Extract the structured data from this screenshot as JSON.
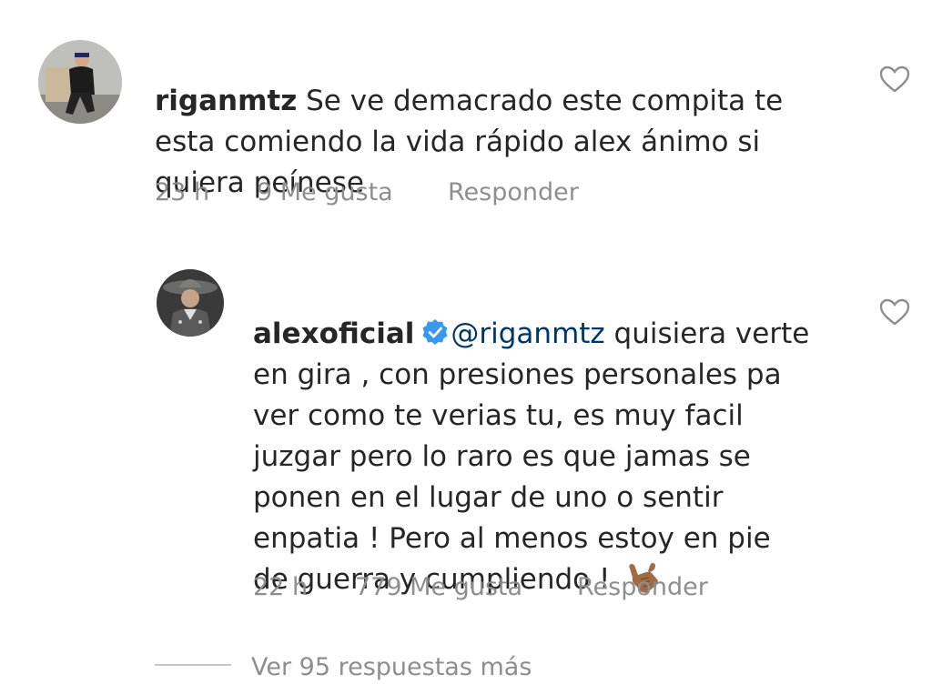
{
  "comments": [
    {
      "username": "riganmtz",
      "text_line1": " Se ve demacrado este compita te",
      "text_line2": "esta comiendo la vida rápido alex ánimo si",
      "text_line3": "quiera peínese",
      "time": "23 h",
      "likes": "9 Me gusta",
      "reply": "Responder",
      "heart_icon": "heart-outline-icon"
    },
    {
      "username": "alexoficial",
      "verified_icon": "verified-badge-icon",
      "mention": "@riganmtz",
      "text_line1_rest": " quisiera verte",
      "text_line2": "en gira , con presiones personales pa",
      "text_line3": "ver como te verias tu, es muy facil",
      "text_line4": "juzgar pero lo raro es que jamas se",
      "text_line5": "ponen en el lugar de uno o sentir",
      "text_line6": "enpatia !  Pero al menos estoy en pie",
      "text_line7": "de guerra y cumpliendo ! ",
      "emoji_icon": "call-me-hand-emoji-icon",
      "time": "22 h",
      "likes": "779 Me gusta",
      "reply": "Responder",
      "heart_icon": "heart-outline-icon"
    }
  ],
  "view_more": "Ver 95 respuestas más",
  "colors": {
    "text": "#262626",
    "meta": "#8e8e8e",
    "mention": "#00376b",
    "verified": "#3897f0"
  }
}
